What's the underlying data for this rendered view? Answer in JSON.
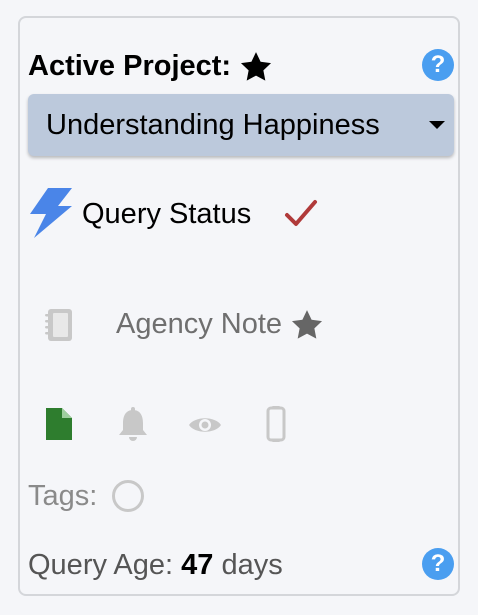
{
  "project": {
    "label": "Active Project:",
    "selected": "Understanding Happiness",
    "help": "?"
  },
  "query_status": {
    "label": "Query Status"
  },
  "agency_note": {
    "label": "Agency Note"
  },
  "tags": {
    "label": "Tags:"
  },
  "query_age": {
    "label": "Query Age:",
    "value": "47",
    "unit": "days",
    "help": "?"
  },
  "icons": {
    "star": "star-icon",
    "help": "help-icon",
    "bolt": "bolt-icon",
    "check": "check-icon",
    "notebook": "notebook-icon",
    "document": "document-icon",
    "bell": "bell-icon",
    "eye": "eye-icon",
    "phone": "phone-icon",
    "tag_circle": "circle-icon"
  },
  "colors": {
    "accent_blue": "#4a9ef0",
    "select_bg": "#bcc9dc",
    "bolt_blue": "#4a85e8",
    "check_red": "#b03a3a",
    "doc_green": "#2e7d2e",
    "muted_gray": "#c8c8c8"
  }
}
